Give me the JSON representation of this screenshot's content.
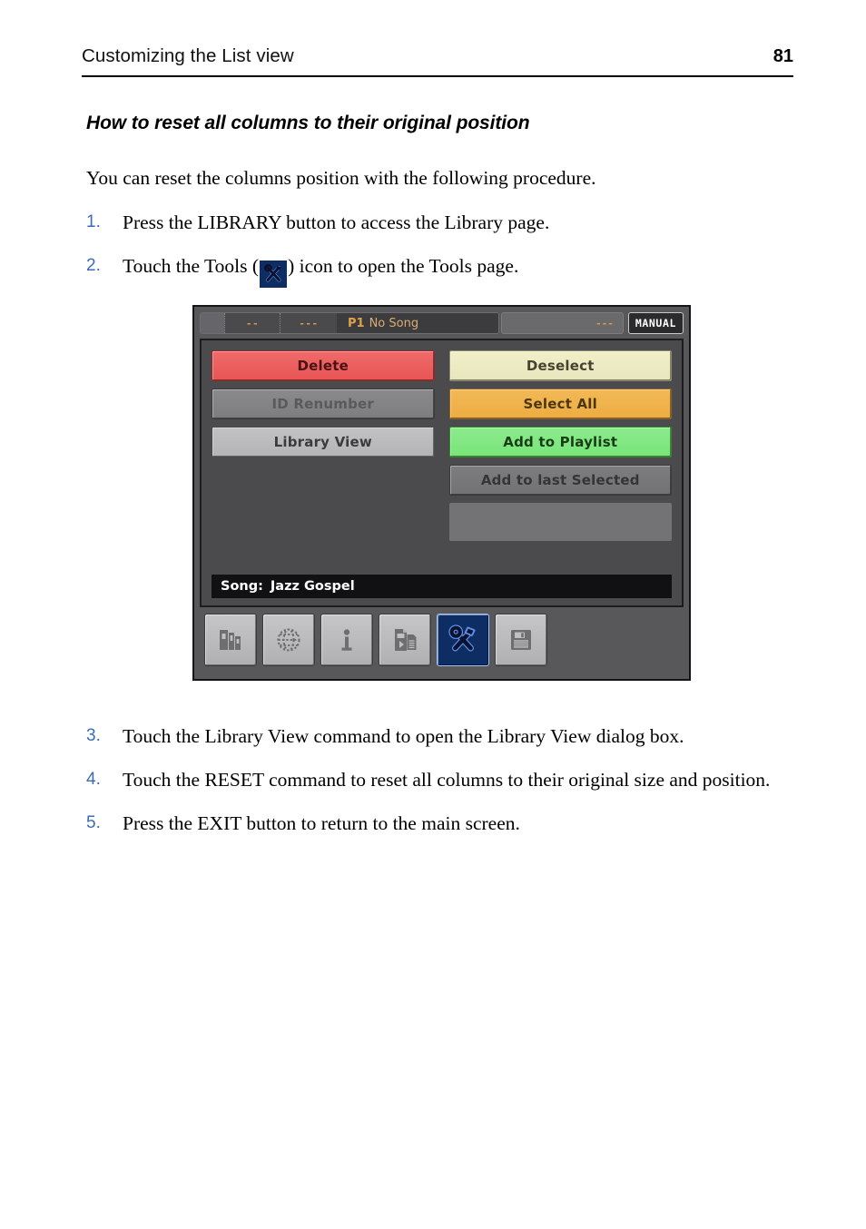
{
  "header": {
    "title": "Customizing the List view",
    "page_number": "81"
  },
  "section": {
    "heading": "How to reset all columns to their original position",
    "intro": "You can reset the columns position with the following procedure."
  },
  "steps_before_figure": [
    {
      "number": "1.",
      "text_full": "Press the LIBRARY button to access the Library page.",
      "text_before_icon": "",
      "text_after_icon": ""
    },
    {
      "number": "2.",
      "text_before_icon": "Touch the Tools (",
      "icon": "tools-icon",
      "text_after_icon": ") icon to open the Tools page."
    }
  ],
  "steps_after_figure": [
    {
      "number": "3.",
      "text": "Touch the Library View command to open the Library View dialog box."
    },
    {
      "number": "4.",
      "text": "Touch the RESET command to reset all columns to their original size and position."
    },
    {
      "number": "5.",
      "text": "Press the EXIT button to return to the main screen."
    }
  ],
  "device_screen": {
    "title_bar": {
      "cell_blank": "",
      "cell_dash_1": "--",
      "cell_dash_2": "---",
      "song_prefix": "P1",
      "song_name": "No Song",
      "right_dashes": "---",
      "mode_badge": "MANUAL"
    },
    "buttons": {
      "delete": {
        "label": "Delete",
        "color": "#ea5a5a"
      },
      "deselect": {
        "label": "Deselect",
        "color": "#eeedc4"
      },
      "id_renumber": {
        "label": "ID Renumber",
        "color": "#838385"
      },
      "select_all": {
        "label": "Select All",
        "color": "#f0b24d"
      },
      "library_view": {
        "label": "Library View",
        "color": "#bcbcbe"
      },
      "add_to_playlist": {
        "label": "Add to Playlist",
        "color": "#83e783"
      },
      "add_to_last_selected": {
        "label": "Add to last Selected",
        "color": "#787879"
      },
      "empty_slot": {
        "label": ""
      }
    },
    "footer": {
      "song_label": "Song:",
      "song_value": "Jazz Gospel"
    },
    "toolbar_icons": [
      {
        "name": "library-books-icon",
        "selected": false
      },
      {
        "name": "globe-network-icon",
        "selected": false
      },
      {
        "name": "info-icon",
        "selected": false
      },
      {
        "name": "import-file-icon",
        "selected": false
      },
      {
        "name": "tools-icon",
        "selected": true
      },
      {
        "name": "save-floppy-icon",
        "selected": false
      }
    ],
    "accent_selected_color": "#0d2d63"
  }
}
